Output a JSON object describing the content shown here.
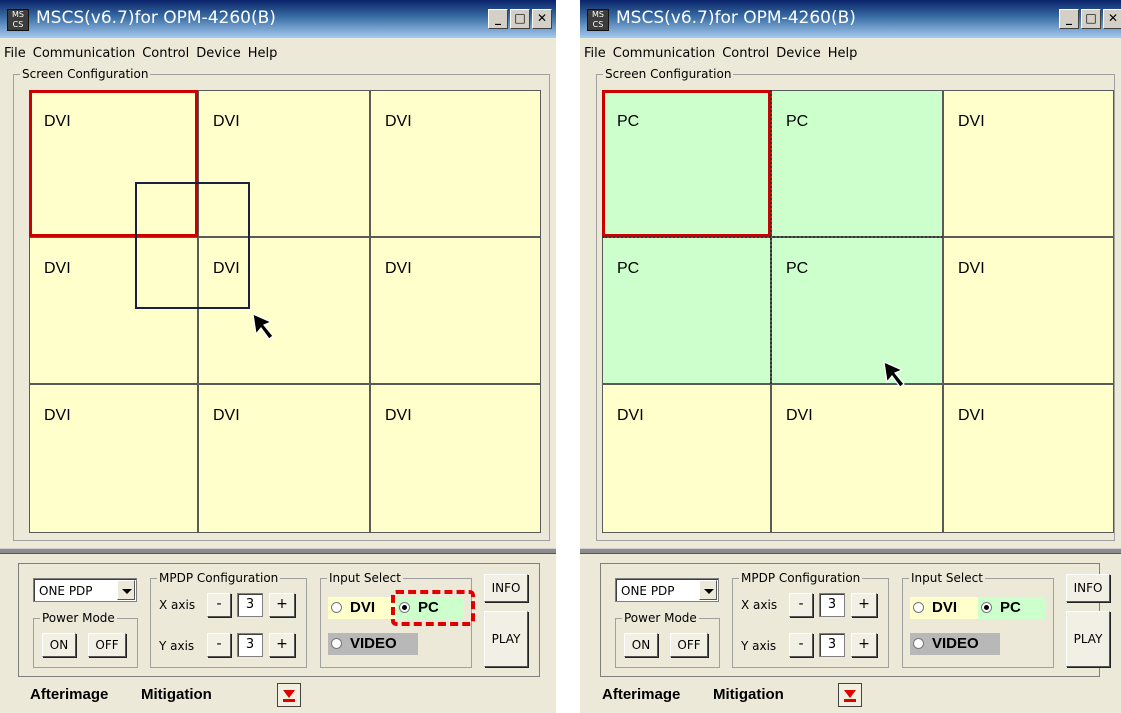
{
  "windows": [
    {
      "title": "MSCS(v6.7)for OPM-4260(B)",
      "icon_text": "MS CS",
      "title_buttons": [
        "minimize-icon",
        "maximize-icon",
        "close-icon"
      ],
      "title_button_glyphs": {
        "minimize": "_",
        "maximize": "□",
        "close": "✕"
      },
      "menu": [
        "File",
        "Communication",
        "Control",
        "Device",
        "Help"
      ],
      "screen_config_label": "Screen Configuration",
      "cells": [
        "DVI",
        "DVI",
        "DVI",
        "DVI",
        "DVI",
        "DVI",
        "DVI",
        "DVI",
        "DVI"
      ],
      "selected_cell": 0,
      "drag_box_visible": true,
      "pc_cells": [],
      "combo_value": "ONE PDP",
      "power_mode_label": "Power Mode",
      "power_on": "ON",
      "power_off": "OFF",
      "mpdp_label": "MPDP Configuration",
      "x_axis_label": "X axis",
      "y_axis_label": "Y axis",
      "x_value": "3",
      "y_value": "3",
      "minus": "-",
      "plus": "+",
      "input_select_label": "Input Select",
      "input_options": [
        "DVI",
        "PC",
        "VIDEO"
      ],
      "input_selected": "PC",
      "pc_highlighted": true,
      "info_button": "INFO",
      "play_button": "PLAY",
      "afterimage": "Afterimage",
      "mitigation": "Mitigation"
    },
    {
      "title": "MSCS(v6.7)for OPM-4260(B)",
      "icon_text": "MS CS",
      "title_buttons": [
        "minimize-icon",
        "maximize-icon",
        "close-icon"
      ],
      "title_button_glyphs": {
        "minimize": "_",
        "maximize": "□",
        "close": "✕"
      },
      "menu": [
        "File",
        "Communication",
        "Control",
        "Device",
        "Help"
      ],
      "screen_config_label": "Screen Configuration",
      "cells": [
        "PC",
        "PC",
        "DVI",
        "PC",
        "PC",
        "DVI",
        "DVI",
        "DVI",
        "DVI"
      ],
      "selected_cell": 0,
      "drag_box_visible": false,
      "pc_cells": [
        0,
        1,
        3,
        4
      ],
      "combo_value": "ONE PDP",
      "power_mode_label": "Power Mode",
      "power_on": "ON",
      "power_off": "OFF",
      "mpdp_label": "MPDP Configuration",
      "x_axis_label": "X axis",
      "y_axis_label": "Y axis",
      "x_value": "3",
      "y_value": "3",
      "minus": "-",
      "plus": "+",
      "input_select_label": "Input Select",
      "input_options": [
        "DVI",
        "PC",
        "VIDEO"
      ],
      "input_selected": "PC",
      "pc_highlighted": false,
      "info_button": "INFO",
      "play_button": "PLAY",
      "afterimage": "Afterimage",
      "mitigation": "Mitigation"
    }
  ],
  "colors": {
    "dvi_cell": "#ffffcc",
    "pc_cell": "#ccffcc",
    "selection_border": "#cc0000",
    "highlight_dash": "#e00000",
    "titlebar_start": "#0a246a",
    "titlebar_end": "#a6caf0"
  }
}
